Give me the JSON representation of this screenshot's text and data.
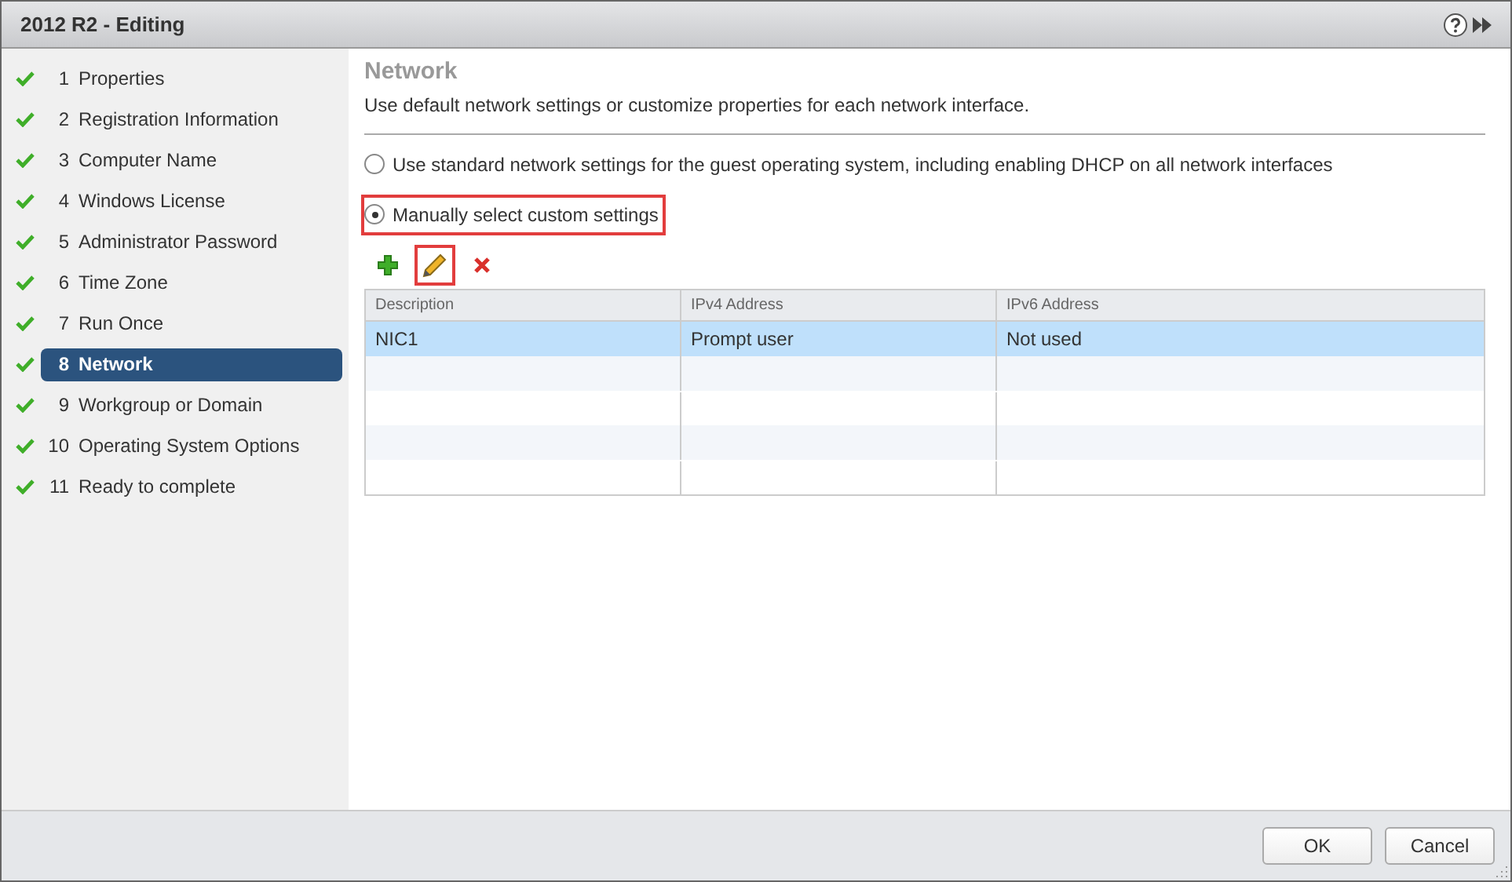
{
  "window": {
    "title": "2012 R2 - Editing"
  },
  "steps": [
    {
      "number": "1",
      "label": "Properties",
      "done": true,
      "selected": false
    },
    {
      "number": "2",
      "label": "Registration Information",
      "done": true,
      "selected": false
    },
    {
      "number": "3",
      "label": "Computer Name",
      "done": true,
      "selected": false
    },
    {
      "number": "4",
      "label": "Windows License",
      "done": true,
      "selected": false
    },
    {
      "number": "5",
      "label": "Administrator Password",
      "done": true,
      "selected": false
    },
    {
      "number": "6",
      "label": "Time Zone",
      "done": true,
      "selected": false
    },
    {
      "number": "7",
      "label": "Run Once",
      "done": true,
      "selected": false
    },
    {
      "number": "8",
      "label": "Network",
      "done": true,
      "selected": true
    },
    {
      "number": "9",
      "label": "Workgroup or Domain",
      "done": true,
      "selected": false
    },
    {
      "number": "10",
      "label": "Operating System Options",
      "done": true,
      "selected": false
    },
    {
      "number": "11",
      "label": "Ready to complete",
      "done": true,
      "selected": false
    }
  ],
  "page": {
    "title": "Network",
    "description": "Use default network settings or customize properties for each network interface."
  },
  "options": [
    {
      "label": "Use standard network settings for the guest operating system, including enabling DHCP on all network interfaces",
      "selected": false,
      "highlighted": false
    },
    {
      "label": "Manually select custom settings",
      "selected": true,
      "highlighted": true
    }
  ],
  "toolbar": [
    {
      "kind": "add",
      "highlighted": false
    },
    {
      "kind": "edit",
      "highlighted": true
    },
    {
      "kind": "remove",
      "highlighted": false
    }
  ],
  "table": {
    "columns": [
      "Description",
      "IPv4 Address",
      "IPv6 Address"
    ],
    "rows": [
      {
        "cells": [
          "NIC1",
          "Prompt user",
          "Not used"
        ],
        "selected": true
      }
    ]
  },
  "buttons": [
    "OK",
    "Cancel"
  ]
}
